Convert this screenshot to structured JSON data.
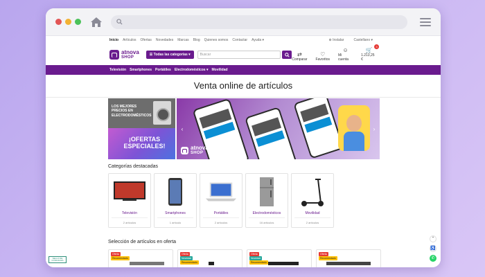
{
  "browser": {
    "search_icon": "search-icon",
    "home_icon": "home-icon",
    "menu_icon": "hamburger-icon",
    "dot_colors": [
      "#e25555",
      "#f2b233",
      "#4cc25a"
    ]
  },
  "topnav": {
    "links": [
      "Inicio",
      "Artículos",
      "Ofertas",
      "Novedades",
      "Marcas",
      "Blog",
      "Quienes somos",
      "Contactar",
      "Ayuda ▾"
    ],
    "install": "⊕ Instalar",
    "language": "Castellano ▾"
  },
  "header": {
    "logo_line1": "atnova",
    "logo_line2": "SHOP",
    "categories_button": "☰ Todas las categorías ▾",
    "search_placeholder": "Buscar",
    "compare": "Comparar",
    "favorites": "Favoritos",
    "account": "Mi cuenta",
    "cart_total": "1.213,25 €",
    "cart_count": "3"
  },
  "mainnav": [
    "Televisión",
    "Smartphones",
    "Portátiles",
    "Electrodomésticos ▾",
    "Movilidad"
  ],
  "page_title": "Venta online de artículos",
  "banners": {
    "top_left": "LOS MEJORES PRECIOS EN ELECTRODOMÉSTICOS",
    "bottom_left": "¡OFERTAS ESPECIALES!",
    "slider_logo_line1": "atnova",
    "slider_logo_line2": "SHOP"
  },
  "featured": {
    "title": "Categorías destacadas",
    "items": [
      {
        "name": "Televisión",
        "count": "2 artículos"
      },
      {
        "name": "Smartphones",
        "count": "1 artículo"
      },
      {
        "name": "Portátiles",
        "count": "2 artículos"
      },
      {
        "name": "Electrodomésticos",
        "count": "16 artículos"
      },
      {
        "name": "Movilidad",
        "count": "2 artículos"
      }
    ]
  },
  "offers": {
    "title": "Selección de artículos en oferta",
    "cards": [
      {
        "tag1": "Oferta",
        "tag2": "Recomendado"
      },
      {
        "tag1": "Oferta",
        "tag2": "Novedad",
        "tag3": "Recomendado"
      },
      {
        "tag1": "Oferta",
        "tag2": "Novedad",
        "tag3": "Recomendado"
      },
      {
        "tag1": "Oferta",
        "tag2": "Recomendado"
      }
    ]
  },
  "trust_badge": "SELLO DE CONFIANZA"
}
